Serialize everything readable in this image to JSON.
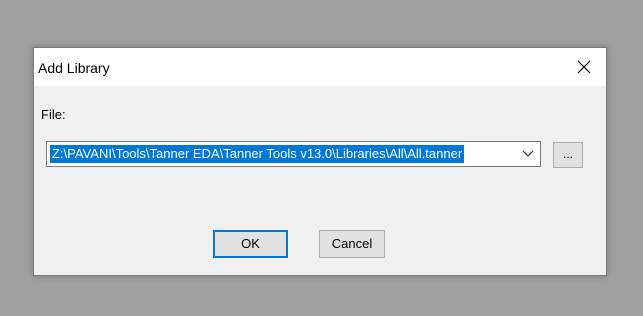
{
  "dialog": {
    "title": "Add Library",
    "close_icon": "close-icon"
  },
  "file": {
    "label": "File:",
    "value": "Z:\\PAVANI\\Tools\\Tanner EDA\\Tanner Tools v13.0\\Libraries\\All\\All.tanner",
    "dropdown_icon": "chevron-down-icon",
    "browse_label": "..."
  },
  "buttons": {
    "ok": "OK",
    "cancel": "Cancel"
  },
  "colors": {
    "selection": "#0078d7",
    "background": "#a0a0a0",
    "dialog": "#f0f0f0"
  }
}
